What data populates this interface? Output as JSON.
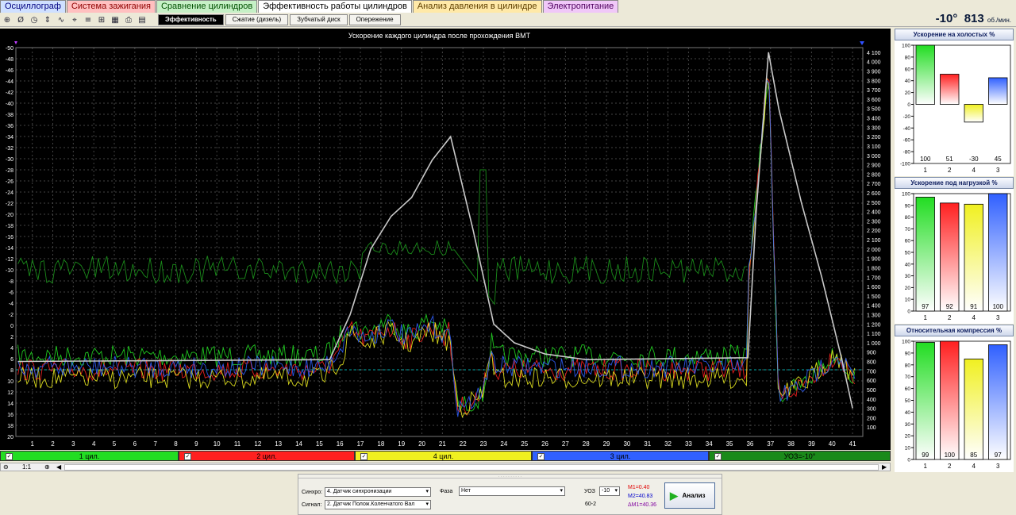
{
  "tabs": [
    {
      "label": "Осциллограф",
      "bg": "#cfe0ff",
      "color": "#000080"
    },
    {
      "label": "Система зажигания",
      "bg": "#ffc0c0",
      "color": "#900000"
    },
    {
      "label": "Сравнение цилиндров",
      "bg": "#c6f0c6",
      "color": "#005000"
    },
    {
      "label": "Эффективность работы цилиндров",
      "bg": "#ffffff",
      "color": "#000000"
    },
    {
      "label": "Анализ давления в цилиндре",
      "bg": "#ffe9a8",
      "color": "#604000"
    },
    {
      "label": "Электропитание",
      "bg": "#f0c8f8",
      "color": "#500060"
    }
  ],
  "toolbar_icons": [
    "zoom-icon",
    "time-icon",
    "clock-icon",
    "scale-icon",
    "filter-icon",
    "cursor-icon",
    "marker-icon",
    "reference-icon",
    "grid-icon",
    "print-icon",
    "export-icon"
  ],
  "subtabs": [
    "Эффективность",
    "Сжатие (дизель)",
    "Зубчатый диск",
    "Опережение"
  ],
  "readout": {
    "angle": "-10°",
    "rpm": "813",
    "unit": "об./мин."
  },
  "chart_data": {
    "type": "line",
    "title": "Ускорение каждого цилиндра после прохождения ВМТ",
    "x_ticks": [
      1,
      2,
      3,
      4,
      5,
      6,
      7,
      8,
      9,
      10,
      11,
      12,
      13,
      14,
      15,
      16,
      17,
      18,
      19,
      20,
      21,
      22,
      23,
      24,
      25,
      26,
      27,
      28,
      29,
      30,
      31,
      32,
      33,
      34,
      35,
      36,
      37,
      38,
      39,
      40,
      41
    ],
    "xlim": [
      0.2,
      41.5
    ],
    "left_ticks": [
      "-50",
      "-48",
      "-46",
      "-44",
      "-42",
      "-40",
      "-38",
      "-36",
      "-34",
      "-32",
      "-30",
      "-28",
      "-26",
      "-24",
      "-22",
      "-20",
      "-18",
      "-16",
      "-14",
      "-12",
      "-10",
      "-8",
      "-6",
      "-4",
      "-2",
      "0",
      "2",
      "4",
      "6",
      "8",
      "10",
      "12",
      "14",
      "16",
      "18",
      "20"
    ],
    "left_ylim": [
      -50,
      20
    ],
    "right_ticks": [
      "4 100",
      "4 000",
      "3 900",
      "3 800",
      "3 700",
      "3 600",
      "3 500",
      "3 400",
      "3 300",
      "3 200",
      "3 100",
      "3 000",
      "2 900",
      "2 800",
      "2 700",
      "2 600",
      "2 500",
      "2 400",
      "2 300",
      "2 200",
      "2 100",
      "2 000",
      "1 900",
      "1 800",
      "1 700",
      "1 600",
      "1 500",
      "1 400",
      "1 300",
      "1 200",
      "1 100",
      "1 000",
      "900",
      "800",
      "700",
      "600",
      "500",
      "400",
      "300",
      "200",
      "100"
    ],
    "right_ylim": [
      0,
      4150
    ],
    "series": [
      {
        "name": "1 цил.",
        "color": "#22dd22"
      },
      {
        "name": "2 цил.",
        "color": "#ff2020"
      },
      {
        "name": "4 цил.",
        "color": "#f0f020"
      },
      {
        "name": "3 цил.",
        "color": "#3060ff"
      },
      {
        "name": "УОЗ=-10°",
        "color": "#1a8a1a"
      }
    ],
    "rpm_curve": [
      [
        0.3,
        800
      ],
      [
        15.5,
        820
      ],
      [
        16.5,
        1300
      ],
      [
        17.5,
        2000
      ],
      [
        18.5,
        2350
      ],
      [
        19.5,
        2550
      ],
      [
        20.5,
        2950
      ],
      [
        21.4,
        3200
      ],
      [
        22.5,
        2200
      ],
      [
        23.5,
        1200
      ],
      [
        24.5,
        1000
      ],
      [
        26,
        880
      ],
      [
        28,
        820
      ],
      [
        35.9,
        840
      ],
      [
        36.3,
        2400
      ],
      [
        36.9,
        4100
      ],
      [
        37.4,
        3500
      ],
      [
        38.5,
        2500
      ],
      [
        39.5,
        1700
      ],
      [
        40.5,
        800
      ],
      [
        41,
        300
      ]
    ],
    "bars": [
      {
        "title": "Ускорение на холостых %",
        "ylim": [
          -100,
          100
        ],
        "ticks": [
          "100",
          "80",
          "60",
          "40",
          "20",
          "0",
          "-20",
          "-40",
          "-60",
          "-80",
          "-100"
        ],
        "categories": [
          "1",
          "2",
          "4",
          "3"
        ],
        "values": [
          100,
          51,
          -30,
          45
        ]
      },
      {
        "title": "Ускорение под нагрузкой %",
        "ylim": [
          0,
          100
        ],
        "ticks": [
          "100",
          "90",
          "80",
          "70",
          "60",
          "50",
          "40",
          "30",
          "20",
          "10",
          "0"
        ],
        "categories": [
          "1",
          "2",
          "4",
          "3"
        ],
        "values": [
          97,
          92,
          91,
          100
        ]
      },
      {
        "title": "Относительная компрессия %",
        "ylim": [
          0,
          100
        ],
        "ticks": [
          "100",
          "90",
          "80",
          "70",
          "60",
          "50",
          "40",
          "30",
          "20",
          "10",
          "0"
        ],
        "categories": [
          "1",
          "2",
          "4",
          "3"
        ],
        "values": [
          99,
          100,
          85,
          97
        ]
      }
    ]
  },
  "channels": [
    {
      "label": "1 цил.",
      "bg": "#22dd22",
      "check": "✓"
    },
    {
      "label": "2 цил.",
      "bg": "#ff2020",
      "check": "✓"
    },
    {
      "label": "4 цил.",
      "bg": "#f0f020",
      "check": "✓"
    },
    {
      "label": "3 цил.",
      "bg": "#3060ff",
      "check": "✓"
    },
    {
      "label": "УОЗ=-10°",
      "bg": "#1a8a1a",
      "check": "✓"
    }
  ],
  "zoom_label": "1:1",
  "bottom": {
    "sync_label": "Синхро:",
    "sync_value": "4. Датчик синхронизации",
    "signal_label": "Сигнал:",
    "signal_value": "2. Датчик Полож.Коленчатого Вал",
    "phase_label": "Фаза",
    "phase_value": "Нет",
    "uoz_label": "УОЗ",
    "uoz_value": "-10",
    "teeth": "60-2",
    "m1": "M1=0.40",
    "m2": "M2=40.83",
    "dm": "ΔM1=40.36",
    "run_label": "Анализ"
  }
}
